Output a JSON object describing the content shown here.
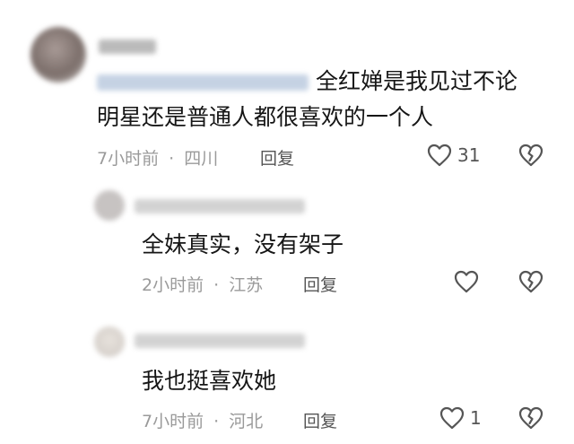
{
  "comments": [
    {
      "text_line1": "全红婵是我见过不论",
      "text_line2": "明星还是普通人都很喜欢的一个人",
      "time": "7小时前",
      "location": "四川",
      "reply_label": "回复",
      "likes": "31",
      "like_icon": "heart-outline-icon",
      "dislike_icon": "broken-heart-icon"
    },
    {
      "text": "全妹真实，没有架子",
      "time": "2小时前",
      "location": "江苏",
      "reply_label": "回复",
      "likes": "",
      "like_icon": "heart-outline-icon",
      "dislike_icon": "broken-heart-icon"
    },
    {
      "text": "我也挺喜欢她",
      "time": "7小时前",
      "location": "河北",
      "reply_label": "回复",
      "likes": "1",
      "like_icon": "heart-outline-icon",
      "dislike_icon": "broken-heart-icon"
    }
  ],
  "separator": "·",
  "colors": {
    "text": "#161616",
    "meta": "#9a9a9a",
    "icon": "#555555",
    "avatar_blur": "#7c6f6b"
  }
}
